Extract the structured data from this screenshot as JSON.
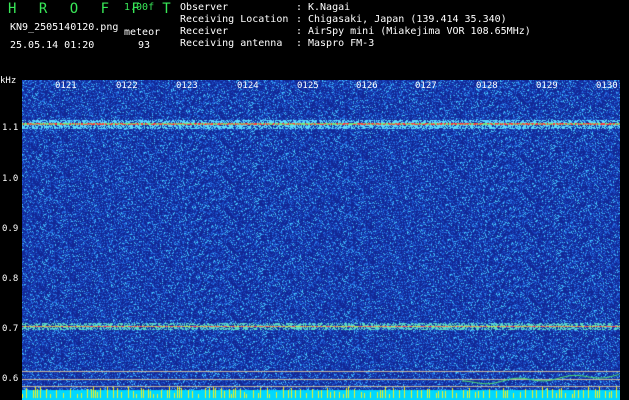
{
  "header": {
    "title": "H R O F F T",
    "version": "1.00f",
    "filename": "KN9_2505140120.png",
    "sensor": "meteor",
    "datetime": "25.05.14 01:20",
    "count": "93",
    "meta": [
      {
        "label": "Observer",
        "value": "K.Nagai"
      },
      {
        "label": "Receiving Location",
        "value": "Chigasaki, Japan (139.414 35.340)"
      },
      {
        "label": "Receiver",
        "value": "AirSpy mini (Miakejima VOR 108.65MHz)"
      },
      {
        "label": "Receiving antenna",
        "value": "Maspro FM-3"
      }
    ]
  },
  "spectrogram": {
    "y_unit": "kHz",
    "y_ticks": [
      "1.1",
      "1.0",
      "0.9",
      "0.8",
      "0.7",
      "0.6"
    ],
    "x_ticks": [
      "0121",
      "0122",
      "0123",
      "0124",
      "0125",
      "0126",
      "0127",
      "0128",
      "0129",
      "0130"
    ],
    "colors": {
      "background": "#1a3a9e",
      "noise_bright": "#4fe0ff",
      "carrier": "#ff4040",
      "baseline": "#00d8ff"
    }
  }
}
